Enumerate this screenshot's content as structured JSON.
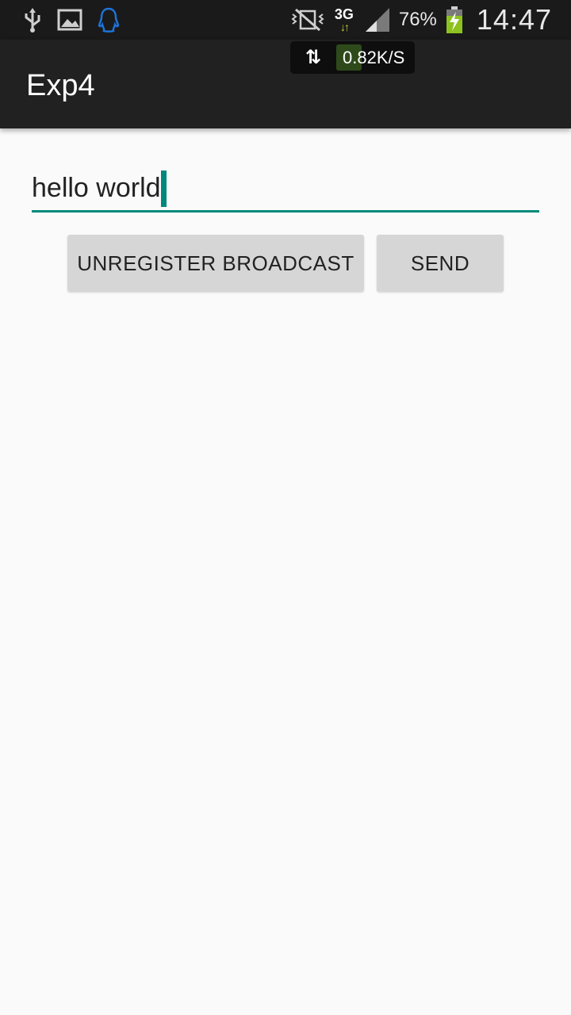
{
  "status_bar": {
    "left_icons": [
      "usb-icon",
      "image-icon",
      "qq-penguin-icon"
    ],
    "right_icons": [
      "mute-vibrate-icon",
      "3g-data-icon",
      "signal-icon",
      "battery-charging-icon"
    ],
    "network_type": "3G",
    "network_arrows": "↓↑",
    "battery_percent": "76%",
    "time": "14:47",
    "accent_color": "#c9d93a"
  },
  "net_speed": {
    "speed": "0.82K/S",
    "arrows": "⇅"
  },
  "app_bar": {
    "title": "Exp4"
  },
  "edit_text": {
    "value": "hello world",
    "accent_color": "#00897b"
  },
  "buttons": {
    "unregister_label": "UNREGISTER BROADCAST",
    "send_label": "SEND"
  }
}
